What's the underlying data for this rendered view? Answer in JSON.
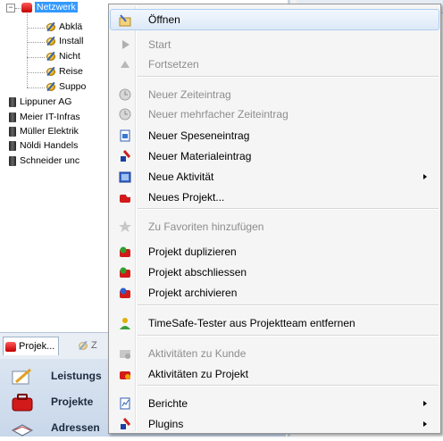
{
  "tree": {
    "selected_project": "Netzwerk",
    "tasks": [
      "Abklä",
      "Install",
      "Nicht",
      "Reise",
      "Suppo"
    ],
    "clients": [
      "Lippuner AG",
      "Meier IT-Infras",
      "Müller Elektrik",
      "Nöldi Handels",
      "Schneider unc"
    ]
  },
  "tabs": {
    "projects": "Projek...",
    "second": "Z"
  },
  "nav": {
    "leistungen": "Leistungs",
    "projekte": "Projekte",
    "adressen": "Adressen"
  },
  "right_fragments": {
    "a": "s",
    "b": "ri"
  },
  "context_menu": {
    "items": [
      {
        "label": "Öffnen",
        "icon": "open-icon",
        "disabled": false,
        "submenu": false
      },
      {
        "label": "Start",
        "icon": "play-icon",
        "disabled": true,
        "submenu": false
      },
      {
        "label": "Fortsetzen",
        "icon": "resume-icon",
        "disabled": true,
        "submenu": false
      },
      {
        "label": "Neuer Zeiteintrag",
        "icon": "clock-icon",
        "disabled": true,
        "submenu": false
      },
      {
        "label": "Neuer mehrfacher Zeiteintrag",
        "icon": "clock-multiple-icon",
        "disabled": true,
        "submenu": false
      },
      {
        "label": "Neuer Speseneintrag",
        "icon": "expense-icon",
        "disabled": false,
        "submenu": false
      },
      {
        "label": "Neuer Materialeintrag",
        "icon": "material-icon",
        "disabled": false,
        "submenu": false
      },
      {
        "label": "Neue Aktivität",
        "icon": "activity-icon",
        "disabled": false,
        "submenu": true
      },
      {
        "label": "Neues Projekt...",
        "icon": "new-project-icon",
        "disabled": false,
        "submenu": false
      },
      {
        "label": "Zu Favoriten hinzufügen",
        "icon": "star-icon",
        "disabled": true,
        "submenu": false
      },
      {
        "label": "Projekt duplizieren",
        "icon": "duplicate-project-icon",
        "disabled": false,
        "submenu": false
      },
      {
        "label": "Projekt abschliessen",
        "icon": "close-project-icon",
        "disabled": false,
        "submenu": false
      },
      {
        "label": "Projekt archivieren",
        "icon": "archive-project-icon",
        "disabled": false,
        "submenu": false
      },
      {
        "label": "TimeSafe-Tester aus Projektteam entfernen",
        "icon": "remove-user-icon",
        "disabled": false,
        "submenu": false
      },
      {
        "label": "Aktivitäten zu Kunde",
        "icon": "client-activities-icon",
        "disabled": true,
        "submenu": false
      },
      {
        "label": "Aktivitäten zu Projekt",
        "icon": "project-activities-icon",
        "disabled": false,
        "submenu": false
      },
      {
        "label": "Berichte",
        "icon": "report-icon",
        "disabled": false,
        "submenu": true
      },
      {
        "label": "Plugins",
        "icon": "plugin-icon",
        "disabled": false,
        "submenu": true
      }
    ]
  },
  "colors": {
    "selection": "#3399ff",
    "menu_bg": "#f5f5f5",
    "disabled_text": "#8d8d8d"
  }
}
